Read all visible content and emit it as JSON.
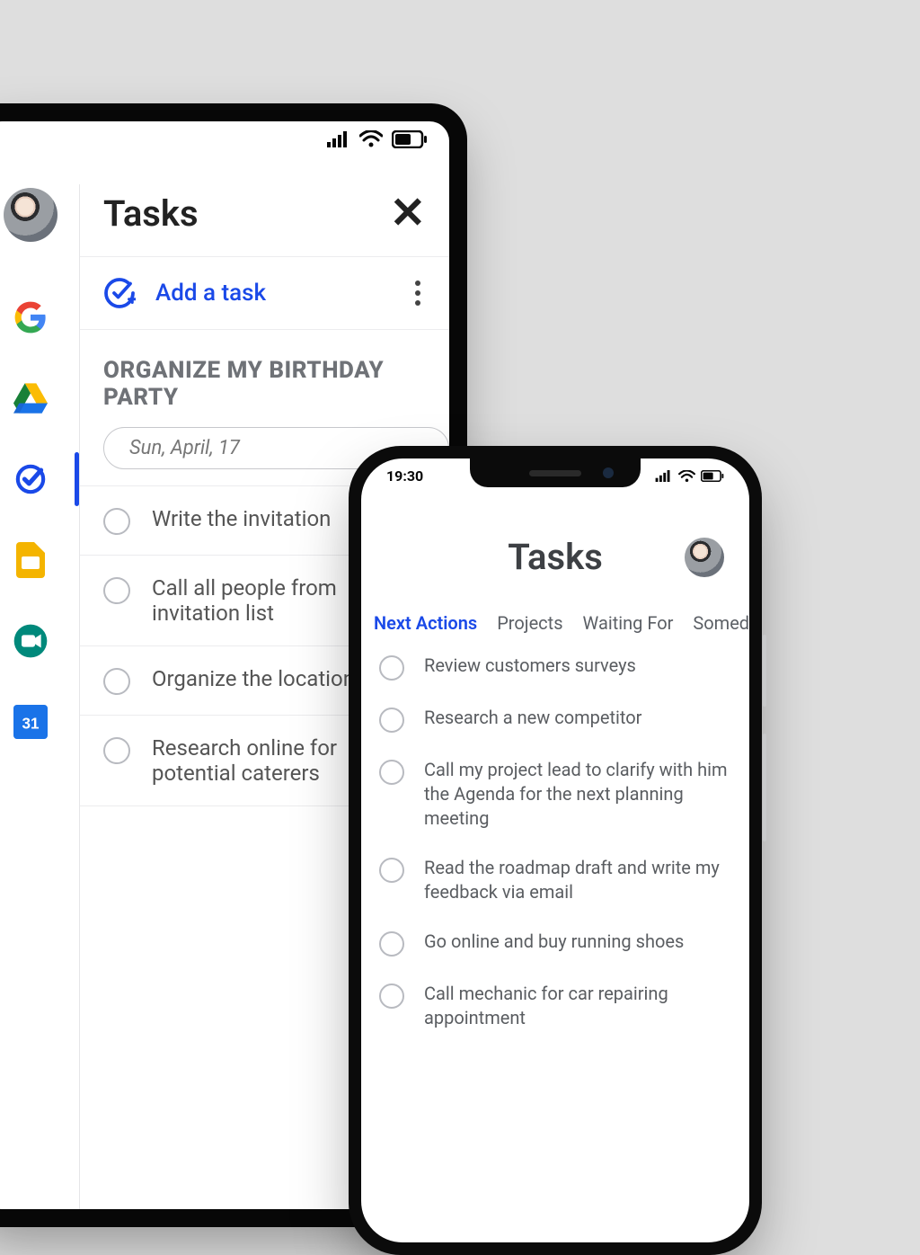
{
  "tablet": {
    "sidebar_icons": [
      "avatar",
      "google",
      "drive",
      "tasks",
      "slides",
      "meet",
      "calendar"
    ],
    "active_sidebar_index": 3,
    "title": "Tasks",
    "add_task_label": "Add a task",
    "section_title": "ORGANIZE MY BIRTHDAY PARTY",
    "date_chip": "Sun, April, 17",
    "tasks": [
      "Write the invitation",
      "Call all people from invitation list",
      "Organize the location",
      "Research online for potential caterers"
    ]
  },
  "phone": {
    "time": "19:30",
    "title": "Tasks",
    "tabs": [
      "Next Actions",
      "Projects",
      "Waiting For",
      "Someday"
    ],
    "active_tab_index": 0,
    "tasks": [
      "Review customers surveys",
      "Research a new competitor",
      "Call my project lead to clarify with him the Agenda for the next planning meeting",
      "Read the roadmap draft and write my feedback via email",
      "Go online and buy running shoes",
      "Call mechanic for car repairing appointment"
    ]
  },
  "calendar_day": "31"
}
